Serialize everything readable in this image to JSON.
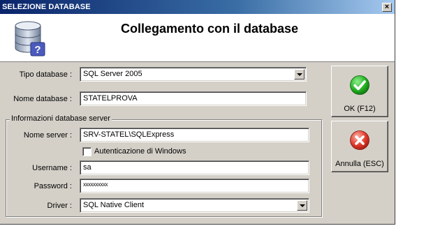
{
  "window": {
    "title": "SELEZIONE DATABASE",
    "close_glyph": "×"
  },
  "header": {
    "title": "Collegamento con il database",
    "icon": "database-question-icon"
  },
  "form": {
    "tipo_label": "Tipo database :",
    "tipo_value": "SQL Server 2005",
    "nome_db_label": "Nome database :",
    "nome_db_value": "STATELPROVA"
  },
  "server_group": {
    "caption": "Informazioni database server",
    "server_label": "Nome server :",
    "server_value": "SRV-STATEL\\SQLExpress",
    "windows_auth_label": "Autenticazione di Windows",
    "windows_auth_checked": false,
    "username_label": "Username :",
    "username_value": "sa",
    "password_label": "Password :",
    "password_value": "xxxxxxxxxx",
    "driver_label": "Driver :",
    "driver_value": "SQL Native Client"
  },
  "buttons": {
    "ok_label": "OK (F12)",
    "ok_icon": "green-check-icon",
    "cancel_label": "Annulla (ESC)",
    "cancel_icon": "red-x-icon"
  },
  "colors": {
    "title_start": "#0a246a",
    "title_end": "#a6caf0",
    "ok_green": "#1fa31f",
    "cancel_red": "#e0392b"
  }
}
